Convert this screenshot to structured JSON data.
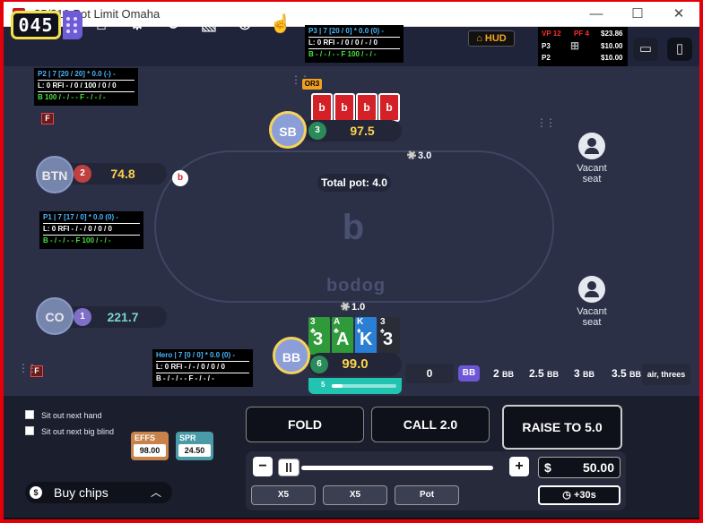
{
  "window": {
    "title": "$5/$10 Pot Limit Omaha",
    "minimize": "—",
    "maximize": "☐",
    "close": "✕"
  },
  "toolbar": {
    "counter": "045",
    "hud_label": "HUD"
  },
  "vp_hud": {
    "vp": "VP 12",
    "pf": "PF 4",
    "amount": "$23.86",
    "p3": "P3",
    "p3_val": "$10.00",
    "p2": "P2",
    "p2_val": "$10.00"
  },
  "huds": {
    "p3": {
      "r1": "P3 | 7 [20 / 0] * 0.0 (0) -",
      "r2": "L: 0 RFI - / 0 / 0 / - / 0",
      "r3": "B - / - / - - F 100 / - / -"
    },
    "p2": {
      "r1": "P2 | 7 [20 / 20] * 0.0 (-) -",
      "r2": "L: 0 RFI - / 0 / 100 / 0 / 0",
      "r3": "B 100 / - / - - F - / - / -"
    },
    "p1": {
      "r1": "P1 | 7 [17 / 0] * 0.0 (0) -",
      "r2": "L: 0 RFI - / - / 0 / 0 / 0",
      "r3": "B - / - / - - F 100 / - / -"
    },
    "hero": {
      "r1": "Hero | 7 [0 / 0] * 0.0 (0) -",
      "r2": "L: 0 RFI - / - / 0 / 0 / 0",
      "r3": "B - / - / - - F - / - / -"
    }
  },
  "tags": {
    "or3": "OR3",
    "f": "F"
  },
  "table": {
    "pot_label": "Total pot:",
    "pot_value": "4.0",
    "logo_b": "b",
    "logo_word": "bodog"
  },
  "players": {
    "sb": {
      "pos": "SB",
      "seat": "3",
      "stack": "97.5",
      "bet": "3.0"
    },
    "btn": {
      "pos": "BTN",
      "seat": "2",
      "stack": "74.8",
      "dealer": "b"
    },
    "co": {
      "pos": "CO",
      "seat": "1",
      "stack": "221.7"
    },
    "bb": {
      "pos": "BB",
      "seat": "6",
      "stack": "99.0",
      "bet": "1.0",
      "timer_label": "5"
    }
  },
  "sb_cards": [
    "b",
    "b",
    "b",
    "b"
  ],
  "hero_cards": [
    {
      "rank": "3",
      "suit": "♣",
      "color": "#2f9a3a"
    },
    {
      "rank": "A",
      "suit": "♣",
      "color": "#2f9a3a"
    },
    {
      "rank": "K",
      "suit": "♦",
      "color": "#2a7fd4"
    },
    {
      "rank": "3",
      "suit": "♠",
      "color": "#2a2c36"
    }
  ],
  "vacant": {
    "label1": "Vacant",
    "label2": "seat"
  },
  "presets": {
    "bet_input": "0",
    "bb": "BB",
    "p1": "2",
    "p2": "2.5",
    "p3": "3",
    "p4": "3.5",
    "unit": "BB",
    "air": "air, threes"
  },
  "action": {
    "sit_out_hand": "Sit out next hand",
    "sit_out_bb": "Sit out next big blind",
    "effs_label": "EFFS",
    "effs_value": "98.00",
    "spr_label": "SPR",
    "spr_value": "24.50",
    "buy_chips": "Buy chips",
    "buy_icon": "$",
    "chev": "︿",
    "fold": "FOLD",
    "call": "CALL 2.0",
    "raise": "RAISE TO 5.0",
    "minus": "−",
    "plus": "+",
    "currency": "$",
    "amount": "50.00",
    "x5a": "X5",
    "x5b": "X5",
    "pot": "Pot",
    "timebank": "+30s"
  },
  "colors": {
    "accent": "#6d57d6",
    "frame": "#e3000b",
    "stack": "#ffd24d",
    "timer": "#20c4b0"
  }
}
